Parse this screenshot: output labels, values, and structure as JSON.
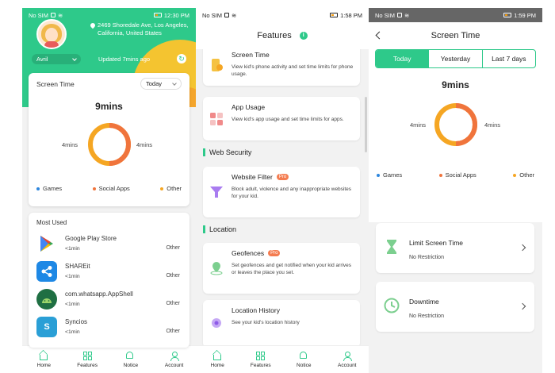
{
  "colors": {
    "accent": "#2ec98a",
    "games": "#2e86de",
    "social": "#f0743c",
    "other": "#f5a623"
  },
  "phone1": {
    "status": {
      "carrier": "No SIM",
      "time": "12:30 PM"
    },
    "address": "2469 Shoredale Ave, Los Angeles, California, United States",
    "child_name": "Avril",
    "updated": "Updated 7mins ago",
    "screen_time": {
      "title": "Screen Time",
      "range": "Today",
      "total": "9mins",
      "left_label": "4mins",
      "right_label": "4mins",
      "legend": [
        "Games",
        "Social Apps",
        "Other"
      ]
    },
    "most_used": {
      "title": "Most Used",
      "apps": [
        {
          "name": "Google Play Store",
          "time": "<1min",
          "category": "Other",
          "icon": "google-play-icon"
        },
        {
          "name": "SHAREit",
          "time": "<1min",
          "category": "Other",
          "icon": "shareit-icon"
        },
        {
          "name": "com.whatsapp.AppShell",
          "time": "<1min",
          "category": "Other",
          "icon": "android-icon"
        },
        {
          "name": "Syncios",
          "time": "<1min",
          "category": "Other",
          "icon": "syncios-icon"
        }
      ]
    },
    "tabs": [
      "Home",
      "Features",
      "Notice",
      "Account"
    ]
  },
  "phone2": {
    "status": {
      "carrier": "No SIM",
      "time": "1:58 PM"
    },
    "title": "Features",
    "screen_time": {
      "title": "Screen Time",
      "desc": "View kid's phone activity and set time limits for phone usage."
    },
    "app_usage": {
      "title": "App Usage",
      "desc": "View kid's app usage and set time limits for apps."
    },
    "sec_web": "Web Security",
    "website_filter": {
      "title": "Website Filter",
      "badge": "Pro",
      "desc": "Block adult, violence and any inappropriate websites for your kid."
    },
    "sec_location": "Location",
    "geofences": {
      "title": "Geofences",
      "badge": "Pro",
      "desc": "Set geofences and get notified when your kid arrives or leaves the place you set."
    },
    "location_history": {
      "title": "Location History",
      "desc": "See your kid's location history"
    },
    "tabs": [
      "Home",
      "Features",
      "Notice",
      "Account"
    ]
  },
  "phone3": {
    "status": {
      "carrier": "No SIM",
      "time": "1:59 PM"
    },
    "title": "Screen Time",
    "segments": [
      "Today",
      "Yesterday",
      "Last 7 days"
    ],
    "total": "9mins",
    "left_label": "4mins",
    "right_label": "4mins",
    "legend": [
      "Games",
      "Social Apps",
      "Other"
    ],
    "limit": {
      "title": "Limit Screen Time",
      "sub": "No Restriction"
    },
    "downtime": {
      "title": "Downtime",
      "sub": "No Restriction"
    }
  },
  "donut": {
    "social_fraction": 0.5,
    "other_fraction": 0.5
  }
}
